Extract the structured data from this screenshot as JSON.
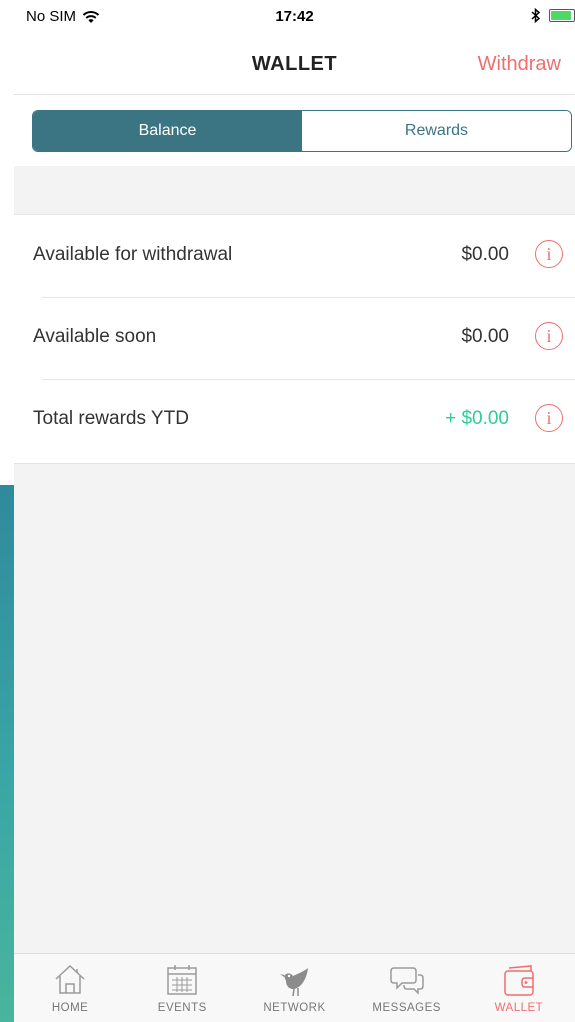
{
  "colors": {
    "teal": "#3b7483",
    "coral": "#f06e6e",
    "green": "#2ecc9a",
    "gray": "#888888"
  },
  "status_bar": {
    "carrier": "No SIM",
    "time": "17:42"
  },
  "nav": {
    "title": "WALLET",
    "action": "Withdraw"
  },
  "segments": [
    {
      "label": "Balance",
      "active": true
    },
    {
      "label": "Rewards",
      "active": false
    }
  ],
  "rows": [
    {
      "label": "Available for withdrawal",
      "value": "$0.00",
      "info": "i"
    },
    {
      "label": "Available soon",
      "value": "$0.00",
      "info": "i"
    },
    {
      "label": "Total rewards YTD",
      "value": "+ $0.00",
      "info": "i"
    }
  ],
  "tabs": [
    {
      "label": "HOME",
      "icon": "home-icon",
      "active": false
    },
    {
      "label": "EVENTS",
      "icon": "calendar-icon",
      "active": false
    },
    {
      "label": "NETWORK",
      "icon": "bird-icon",
      "active": false
    },
    {
      "label": "MESSAGES",
      "icon": "chat-bubbles-icon",
      "active": false
    },
    {
      "label": "WALLET",
      "icon": "wallet-icon",
      "active": true
    }
  ]
}
